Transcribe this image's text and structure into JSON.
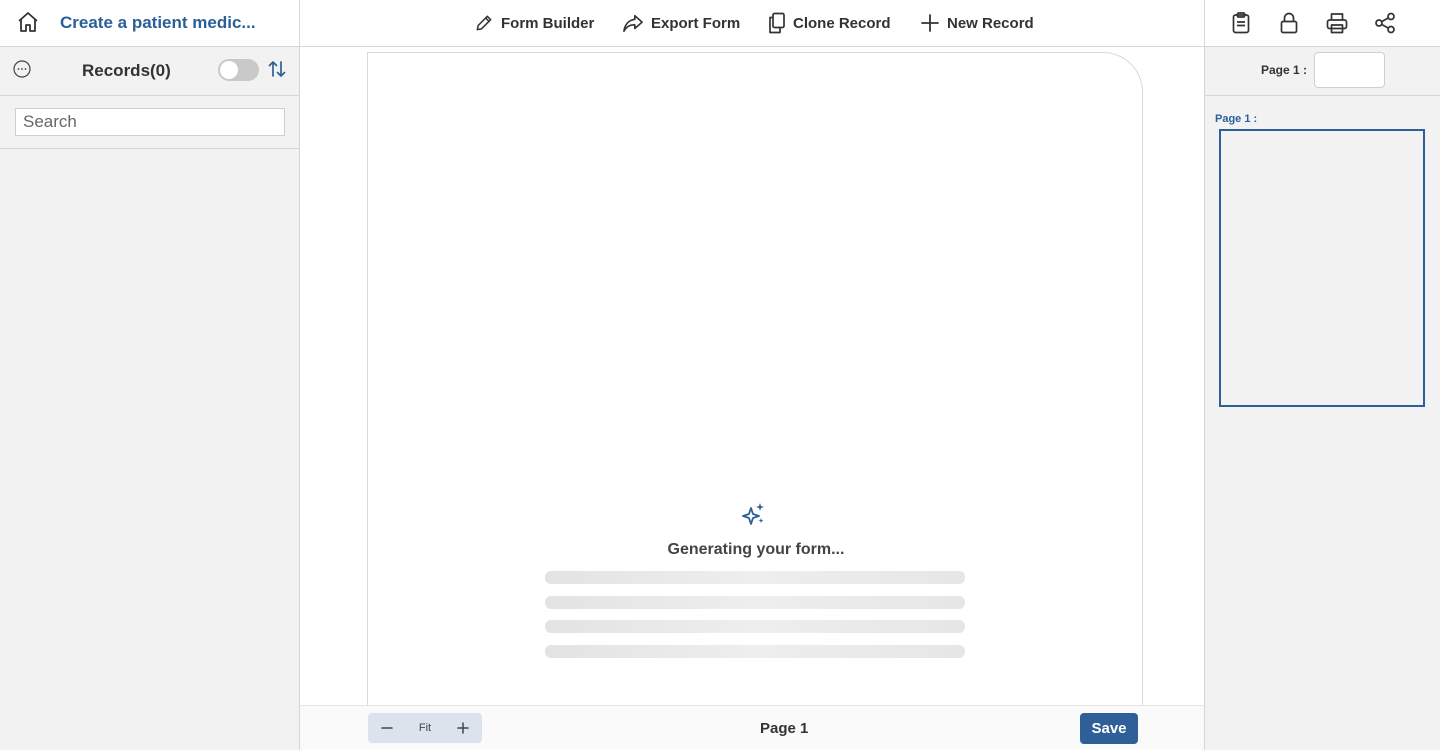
{
  "header": {
    "title": "Create a patient medic...",
    "toolbar": {
      "form_builder": "Form Builder",
      "export_form": "Export Form",
      "clone_record": "Clone Record",
      "new_record": "New Record"
    },
    "icons": [
      "home-icon",
      "pencil-icon",
      "share-arrow-icon",
      "copy-icon",
      "plus-icon",
      "clipboard-icon",
      "lock-icon",
      "printer-icon",
      "share-icon"
    ]
  },
  "sidebar": {
    "records_label": "Records(0)",
    "toggle_on": false,
    "search_placeholder": "Search"
  },
  "canvas": {
    "loading_text": "Generating your form...",
    "zoom_fit_label": "Fit",
    "page_label": "Page 1",
    "save_label": "Save"
  },
  "pages_panel": {
    "page_number_label": "Page 1 :",
    "page_number_value": "",
    "thumbnail_label": "Page 1 :"
  },
  "colors": {
    "accent": "#2f5f98",
    "title": "#2b5f99",
    "panel_bg": "#f2f2f2"
  }
}
